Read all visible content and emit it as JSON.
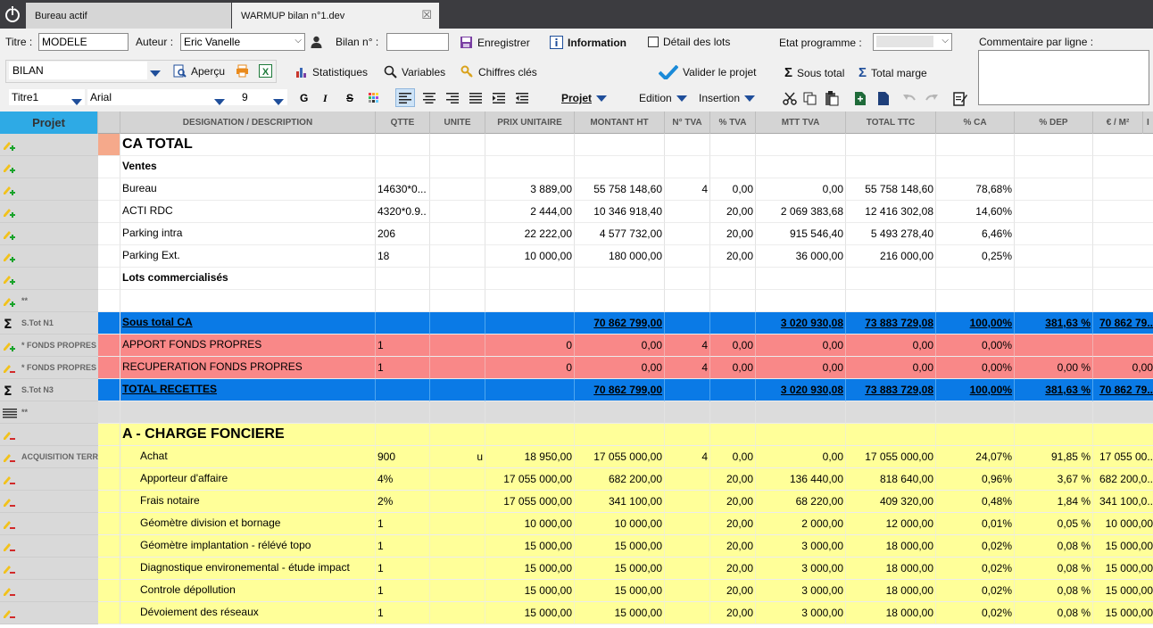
{
  "tabs": [
    {
      "label": "Bureau actif"
    },
    {
      "label": "WARMUP bilan n°1.dev",
      "close": "☒"
    }
  ],
  "form": {
    "titre_label": "Titre :",
    "titre_value": "MODELE",
    "auteur_label": "Auteur :",
    "auteur_value": "Eric Vanelle",
    "bilan_label": "Bilan n° :",
    "bilan_value": "",
    "enregistrer": "Enregistrer",
    "information": "Information",
    "detail_lots": "Détail des lots",
    "etat_programme_label": "Etat programme :",
    "commentaire_label": "Commentaire par ligne :"
  },
  "toolbar2": {
    "view_select": "BILAN",
    "apercu": "Aperçu",
    "statistiques": "Statistiques",
    "variables": "Variables",
    "chiffres_cles": "Chiffres clés",
    "valider": "Valider le projet",
    "sous_total": "Sous total",
    "total_marge": "Total marge"
  },
  "toolbar3": {
    "style": "Titre1",
    "font": "Arial",
    "size": "9",
    "bold": "G",
    "italic": "I",
    "strike": "S",
    "projet": "Projet",
    "edition": "Edition",
    "insertion": "Insertion"
  },
  "colors": {
    "blue": "#0a7ae6",
    "red": "#f98888",
    "yellow": "#ffff99",
    "orange_marker": "#f5a98b"
  },
  "table": {
    "headers": [
      "Projet",
      "DESIGNATION / DESCRIPTION",
      "QTTE",
      "UNITE",
      "PRIX UNITAIRE",
      "MONTANT HT",
      "N° TVA",
      "% TVA",
      "MTT TVA",
      "TOTAL TTC",
      "% CA",
      "% DEP",
      "€ / M²",
      "I"
    ],
    "rows": [
      {
        "side": "",
        "icon": "pencil-plus",
        "bg": "white",
        "marker": true,
        "cells": [
          "CA TOTAL",
          "",
          "",
          "",
          "",
          "",
          "",
          "",
          "",
          "",
          "",
          ""
        ],
        "style": "title"
      },
      {
        "side": "",
        "icon": "pencil-plus",
        "bg": "white",
        "cells": [
          "Ventes",
          "",
          "",
          "",
          "",
          "",
          "",
          "",
          "",
          "",
          "",
          ""
        ],
        "style": "bold"
      },
      {
        "side": "",
        "icon": "pencil-plus",
        "bg": "white",
        "cells": [
          "Bureau",
          "14630*0...",
          "",
          "3 889,00",
          "55 758 148,60",
          "4",
          "0,00",
          "0,00",
          "55 758 148,60",
          "78,68%",
          "",
          ""
        ]
      },
      {
        "side": "",
        "icon": "pencil-plus",
        "bg": "white",
        "cells": [
          "ACTI RDC",
          "4320*0.9..",
          "",
          "2 444,00",
          "10 346 918,40",
          "",
          "20,00",
          "2 069 383,68",
          "12 416 302,08",
          "14,60%",
          "",
          ""
        ]
      },
      {
        "side": "",
        "icon": "pencil-plus",
        "bg": "white",
        "cells": [
          "Parking intra",
          "206",
          "",
          "22 222,00",
          "4 577 732,00",
          "",
          "20,00",
          "915 546,40",
          "5 493 278,40",
          "6,46%",
          "",
          ""
        ]
      },
      {
        "side": "",
        "icon": "pencil-plus",
        "bg": "white",
        "cells": [
          "Parking Ext.",
          "18",
          "",
          "10 000,00",
          "180 000,00",
          "",
          "20,00",
          "36 000,00",
          "216 000,00",
          "0,25%",
          "",
          ""
        ]
      },
      {
        "side": "",
        "icon": "pencil-plus",
        "bg": "white",
        "cells": [
          "Lots commercialisés",
          "",
          "",
          "",
          "",
          "",
          "",
          "",
          "",
          "",
          "",
          ""
        ],
        "style": "bold"
      },
      {
        "side": "**",
        "icon": "pencil-plus",
        "bg": "white",
        "cells": [
          "",
          "",
          "",
          "",
          "",
          "",
          "",
          "",
          "",
          "",
          "",
          ""
        ]
      },
      {
        "side": "S.Tot N1",
        "icon": "sigma",
        "bg": "blue",
        "cells": [
          "Sous total CA",
          "",
          "",
          "",
          "70 862 799,00",
          "",
          "",
          "3 020 930,08",
          "73 883 729,08",
          "100,00%",
          "381,63 %",
          "70 862 79.."
        ],
        "style": "ul"
      },
      {
        "side": "* FONDS PROPRES",
        "icon": "pencil-plus",
        "bg": "red",
        "cells": [
          "APPORT FONDS PROPRES",
          "1",
          "",
          "0",
          "0,00",
          "4",
          "0,00",
          "0,00",
          "0,00",
          "0,00%",
          "",
          ""
        ]
      },
      {
        "side": "* FONDS PROPRES",
        "icon": "pencil-minus",
        "bg": "red",
        "cells": [
          "RECUPERATION FONDS PROPRES",
          "1",
          "",
          "0",
          "0,00",
          "4",
          "0,00",
          "0,00",
          "0,00",
          "0,00%",
          "0,00 %",
          "0,00"
        ]
      },
      {
        "side": "S.Tot N3",
        "icon": "sigma",
        "bg": "blue",
        "cells": [
          "TOTAL RECETTES",
          "",
          "",
          "",
          "70 862 799,00",
          "",
          "",
          "3 020 930,08",
          "73 883 729,08",
          "100,00%",
          "381,63 %",
          "70 862 79.."
        ],
        "style": "ul"
      },
      {
        "side": "**",
        "icon": "lines",
        "bg": "gray",
        "cells": [
          "",
          "",
          "",
          "",
          "",
          "",
          "",
          "",
          "",
          "",
          "",
          ""
        ]
      },
      {
        "side": "",
        "icon": "pencil-minus",
        "bg": "yellow",
        "cells": [
          "A - CHARGE FONCIERE",
          "",
          "",
          "",
          "",
          "",
          "",
          "",
          "",
          "",
          "",
          ""
        ],
        "style": "title"
      },
      {
        "side": "ACQUISITION TERRAIN",
        "icon": "pencil-minus",
        "bg": "yellow",
        "indent": true,
        "cells": [
          "Achat",
          "900",
          "u",
          "18 950,00",
          "17 055 000,00",
          "4",
          "0,00",
          "0,00",
          "17 055 000,00",
          "24,07%",
          "91,85 %",
          "17 055 00.."
        ]
      },
      {
        "side": "",
        "icon": "pencil-minus",
        "bg": "yellow",
        "indent": true,
        "cells": [
          "Apporteur d'affaire",
          "4%",
          "",
          "17 055 000,00",
          "682 200,00",
          "",
          "20,00",
          "136 440,00",
          "818 640,00",
          "0,96%",
          "3,67 %",
          "682 200,0.."
        ]
      },
      {
        "side": "",
        "icon": "pencil-minus",
        "bg": "yellow",
        "indent": true,
        "cells": [
          "Frais notaire",
          "2%",
          "",
          "17 055 000,00",
          "341 100,00",
          "",
          "20,00",
          "68 220,00",
          "409 320,00",
          "0,48%",
          "1,84 %",
          "341 100,0.."
        ]
      },
      {
        "side": "",
        "icon": "pencil-minus",
        "bg": "yellow",
        "indent": true,
        "cells": [
          "Géomètre division et bornage",
          "1",
          "",
          "10 000,00",
          "10 000,00",
          "",
          "20,00",
          "2 000,00",
          "12 000,00",
          "0,01%",
          "0,05 %",
          "10 000,00"
        ]
      },
      {
        "side": "",
        "icon": "pencil-minus",
        "bg": "yellow",
        "indent": true,
        "cells": [
          "Géomètre implantation - rélévé topo",
          "1",
          "",
          "15 000,00",
          "15 000,00",
          "",
          "20,00",
          "3 000,00",
          "18 000,00",
          "0,02%",
          "0,08 %",
          "15 000,00"
        ]
      },
      {
        "side": "",
        "icon": "pencil-minus",
        "bg": "yellow",
        "indent": true,
        "cells": [
          "Diagnostique environemental - étude impact",
          "1",
          "",
          "15 000,00",
          "15 000,00",
          "",
          "20,00",
          "3 000,00",
          "18 000,00",
          "0,02%",
          "0,08 %",
          "15 000,00"
        ]
      },
      {
        "side": "",
        "icon": "pencil-minus",
        "bg": "yellow",
        "indent": true,
        "cells": [
          "Controle dépollution",
          "1",
          "",
          "15 000,00",
          "15 000,00",
          "",
          "20,00",
          "3 000,00",
          "18 000,00",
          "0,02%",
          "0,08 %",
          "15 000,00"
        ]
      },
      {
        "side": "",
        "icon": "pencil-minus",
        "bg": "yellow",
        "indent": true,
        "cells": [
          "Dévoiement des réseaux",
          "1",
          "",
          "15 000,00",
          "15 000,00",
          "",
          "20,00",
          "3 000,00",
          "18 000,00",
          "0,02%",
          "0,08 %",
          "15 000,00"
        ]
      }
    ]
  }
}
